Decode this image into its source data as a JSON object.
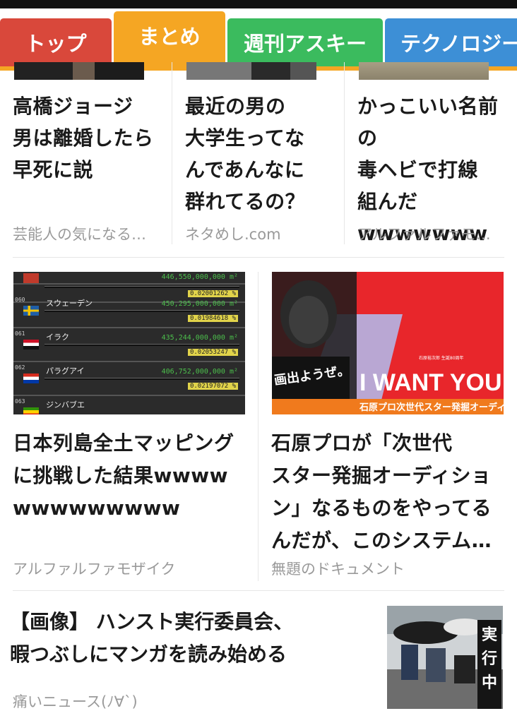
{
  "tabs": [
    {
      "label": "トップ"
    },
    {
      "label": "まとめ"
    },
    {
      "label": "週刊アスキー"
    },
    {
      "label": "テクノロジー"
    }
  ],
  "articles_top": [
    {
      "title": "高橋ジョージ\n男は離婚したら\n早死に説",
      "source": "芸能人の気になる…"
    },
    {
      "title": "最近の男の\n大学生ってな\nんであんなに\n群れてるの？",
      "source": "ネタめし.com"
    },
    {
      "title": "かっこいい名前の\n毒ヘビで打線\n組んだwwwwwww",
      "source": "アルファルファモ…"
    }
  ],
  "articles_mid": [
    {
      "title": "日本列島全土マッピング\nに挑戦した結果wwww\nwwwwwwwww",
      "source": "アルファルファモザイク"
    },
    {
      "title": "石原プロが「次世代\nスター発掘オーディショ\nン」なるものをやってる\nんだが、このシステム…",
      "source": "無題のドキュメント"
    }
  ],
  "article_bottom": {
    "title": "【画像】 ハンスト実行委員会、\n暇つぶしにマンガを読み始める",
    "source": "痛いニュース(ﾉ∀`)"
  },
  "table_image": {
    "top_row": {
      "area": "446,550,000,000 m²",
      "pct": "0.02001262 %"
    },
    "rows": [
      {
        "num": "060",
        "name": "スウェーデン",
        "area": "450,295,000,000 m²",
        "pct": "0.01984618 %",
        "flag": "sweden-flag-icon"
      },
      {
        "num": "061",
        "name": "イラク",
        "area": "435,244,000,000 m²",
        "pct": "0.02053247 %",
        "flag": "iraq-flag-icon"
      },
      {
        "num": "062",
        "name": "パラグアイ",
        "area": "406,752,000,000 m²",
        "pct": "0.02197072 %",
        "flag": "paraguay-flag-icon"
      },
      {
        "num": "063",
        "name": "ジンバブエ",
        "area": "",
        "pct": "",
        "flag": "zimbabwe-flag-icon"
      }
    ]
  },
  "poster": {
    "headline": "I WANT YOU",
    "tagline": "画出ようぜ。",
    "banner": "石原プロ次世代スター発掘オーディション",
    "small": "石原裕次郎 生誕80周年"
  },
  "photo_sign": "実行中",
  "colors": {
    "red": "#d9483b",
    "orange": "#f5a623",
    "green": "#3bbb5e",
    "blue": "#3d8fd6"
  }
}
